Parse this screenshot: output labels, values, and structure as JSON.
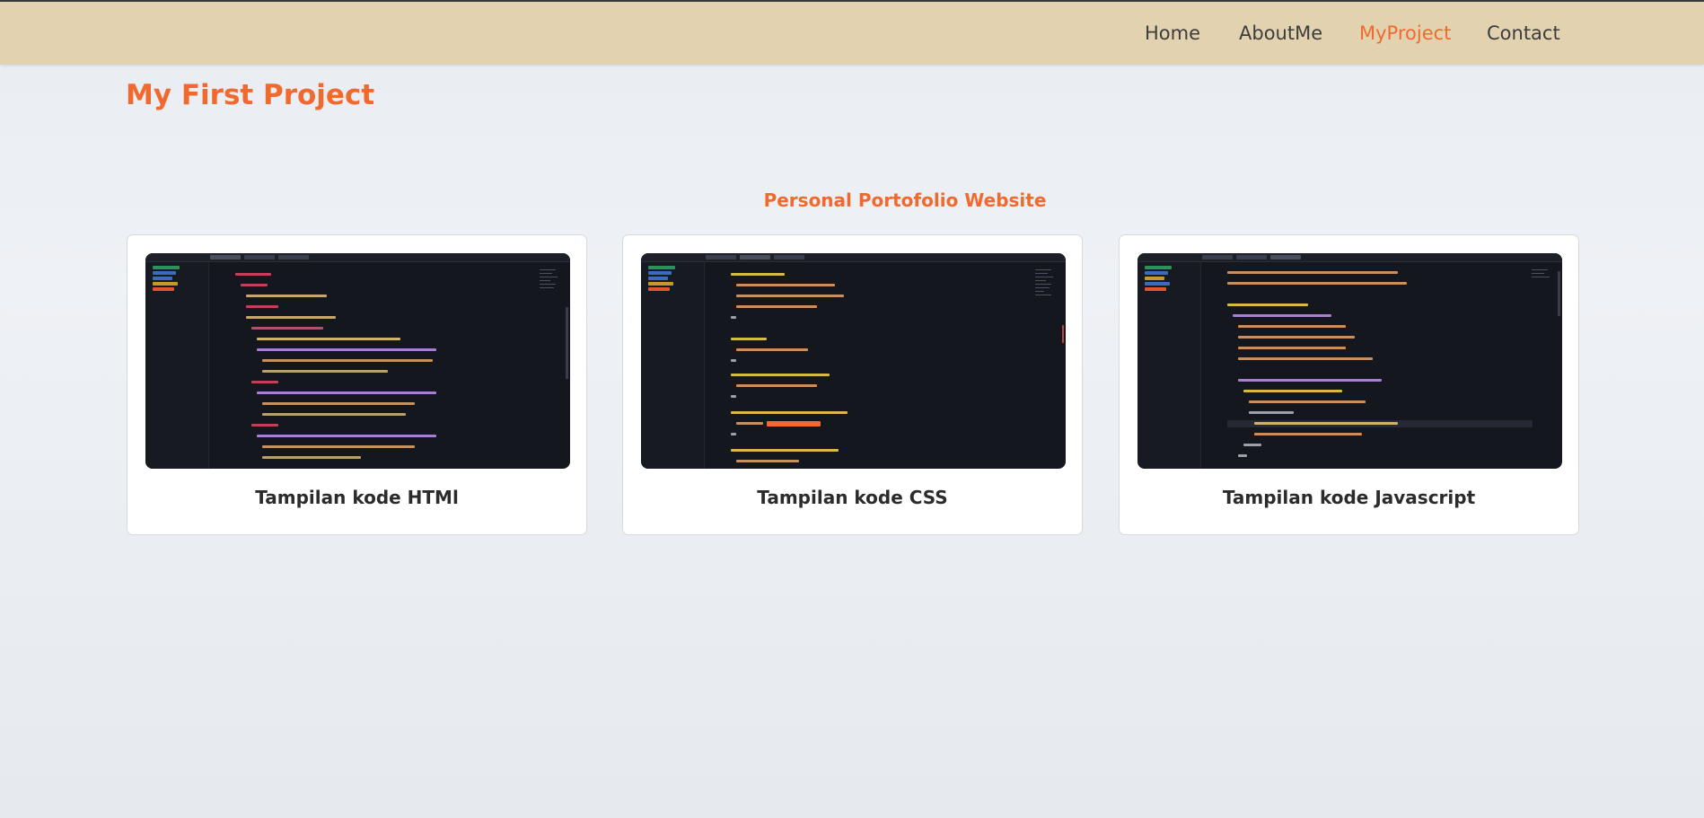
{
  "nav": {
    "items": [
      {
        "label": "Home",
        "active": false
      },
      {
        "label": "AboutMe",
        "active": false
      },
      {
        "label": "MyProject",
        "active": true
      },
      {
        "label": "Contact",
        "active": false
      }
    ]
  },
  "page": {
    "title": "My First Project",
    "section_title": "Personal Portofolio Website"
  },
  "cards": [
    {
      "caption": "Tampilan kode HTMl"
    },
    {
      "caption": "Tampilan kode CSS"
    },
    {
      "caption": "Tampilan kode Javascript"
    }
  ],
  "colors": {
    "accent": "#f06a2f",
    "navbar": "#e3d2b0",
    "text": "#3d3d3d",
    "editor_bg": "#15171e"
  }
}
